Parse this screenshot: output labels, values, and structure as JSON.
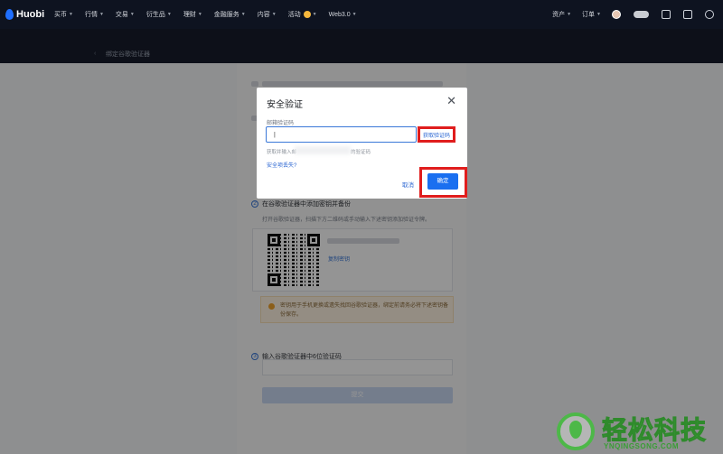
{
  "nav": {
    "logo": "Huobi",
    "items": [
      {
        "label": "买币",
        "caret": true
      },
      {
        "label": "行情",
        "caret": true
      },
      {
        "label": "交易",
        "caret": true
      },
      {
        "label": "衍生品",
        "caret": true
      },
      {
        "label": "理财",
        "caret": true
      },
      {
        "label": "金融服务",
        "caret": true
      },
      {
        "label": "内容",
        "caret": true
      },
      {
        "label": "活动",
        "caret": true
      },
      {
        "label": "Web3.0",
        "caret": true
      }
    ],
    "right": [
      {
        "label": "资产"
      },
      {
        "label": "订单"
      }
    ]
  },
  "page": {
    "back": "‹",
    "title": "绑定谷歌验证器"
  },
  "steps": [
    {
      "num": "2",
      "title": "在谷歌验证器中添加密钥并备份",
      "desc": "打开谷歌验证器，扫描下方二维码或手动输入下述密钥添加验证令牌。"
    },
    {
      "num": "3",
      "title": "输入谷歌验证器中6位验证码"
    }
  ],
  "qr": {
    "copy_label": "复制密钥"
  },
  "warning": {
    "text": "密钥用于手机更换或遗失找回谷歌验证器，绑定前请务必将下述密钥备份保存。"
  },
  "submit": {
    "label": "提交"
  },
  "modal": {
    "title": "安全验证",
    "close": "✕",
    "field_label": "邮箱验证码",
    "field_value": "|",
    "get_code": "获取验证码",
    "hint_prefix": "获取并输入邮",
    "hint_suffix": "的验证码",
    "unavailable": "安全项丢失?",
    "cancel": "取消",
    "confirm": "确定"
  },
  "watermark": {
    "brand": "轻松科技",
    "sub": "YNQINGSONG.COM"
  },
  "colors": {
    "accent": "#1a6ff0",
    "highlight": "#e01d1d",
    "nav_bg": "#0e1320"
  }
}
